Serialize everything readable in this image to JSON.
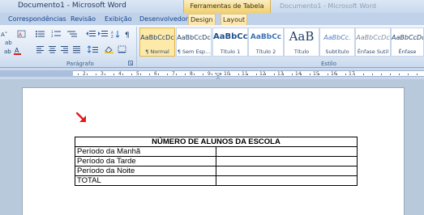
{
  "window": {
    "title": "Documento1 - Microsoft Word",
    "context_tab_group": "Ferramentas de Tabela",
    "faded_title_text": "Documento1 - Microsoft Word"
  },
  "tabs": [
    {
      "label": "Correspondências"
    },
    {
      "label": "Revisão"
    },
    {
      "label": "Exibição"
    },
    {
      "label": "Desenvolvedor"
    },
    {
      "label": "Design"
    },
    {
      "label": "Layout"
    }
  ],
  "ribbon": {
    "paragraph_group_label": "Parágrafo",
    "styles_group_label": "Estilo",
    "styles": [
      {
        "sample": "AaBbCcDc",
        "name": "¶ Normal"
      },
      {
        "sample": "AaBbCcDc",
        "name": "¶ Sem Esp..."
      },
      {
        "sample": "AaBbCc",
        "name": "Título 1"
      },
      {
        "sample": "AaBbCc",
        "name": "Título 2"
      },
      {
        "sample": "AaB",
        "name": "Título"
      },
      {
        "sample": "AaBbCc.",
        "name": "Subtítulo"
      },
      {
        "sample": "AaBbCcDc",
        "name": "Ênfase Sutil"
      },
      {
        "sample": "AaBbCcDc",
        "name": "Ênfase"
      }
    ]
  },
  "ruler": {
    "numbers": [
      "3",
      "2",
      "1",
      "1",
      "2",
      "3",
      "4",
      "5",
      "6",
      "7",
      "8",
      "9",
      "10",
      "11",
      "12",
      "13",
      "14",
      "15",
      "16",
      "17"
    ]
  },
  "document": {
    "table": {
      "header": "NÚMERO DE ALUNOS DA ESCOLA",
      "rows": [
        {
          "label": "Período da Manhã",
          "value": ""
        },
        {
          "label": "Período da Tarde",
          "value": ""
        },
        {
          "label": "Período da Noite",
          "value": ""
        },
        {
          "label": "TOTAL",
          "value": ""
        }
      ]
    }
  },
  "colors": {
    "arrow": "#e31b1b",
    "context_tab": "#f2cf6e"
  }
}
